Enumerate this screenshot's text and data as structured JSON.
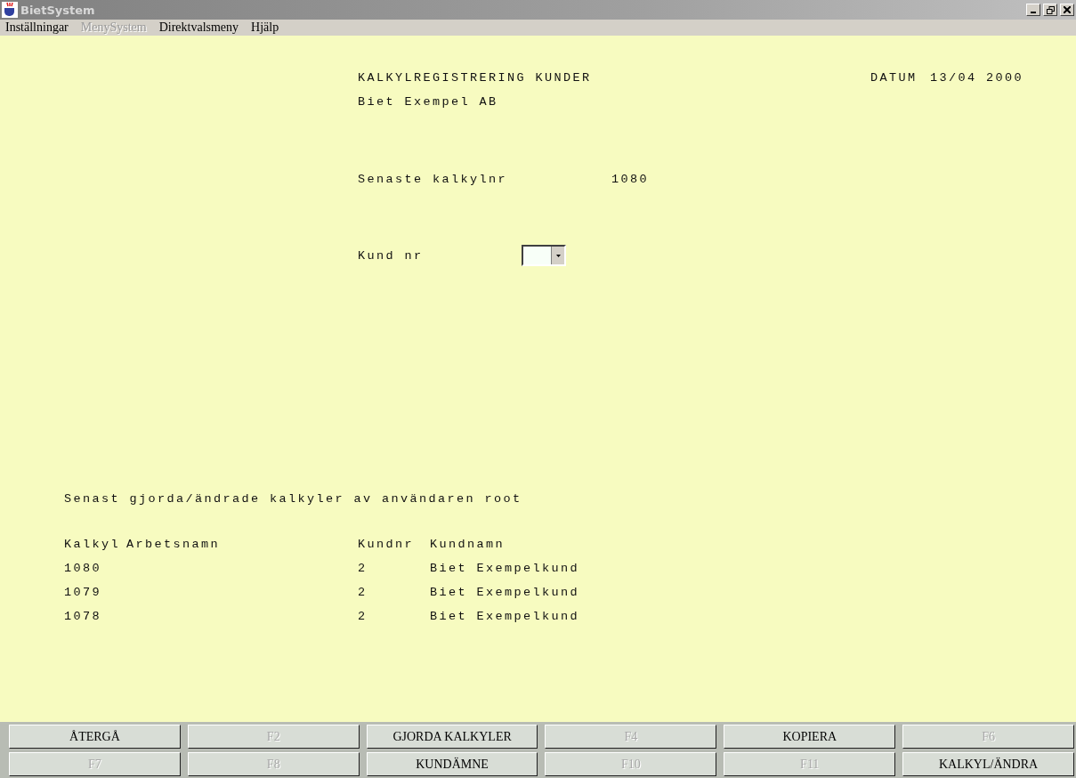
{
  "window": {
    "title": "BietSystem"
  },
  "menu": [
    {
      "label": "Inställningar",
      "disabled": false
    },
    {
      "label": "MenySystem",
      "disabled": true
    },
    {
      "label": "Direktvalsmeny",
      "disabled": false
    },
    {
      "label": "Hjälp",
      "disabled": false
    }
  ],
  "header": {
    "title": "KALKYLREGISTRERING KUNDER",
    "company": "Biet Exempel AB",
    "date_label": "DATUM",
    "date": "13/04 2000"
  },
  "latest": {
    "label": "Senaste kalkylnr",
    "value": "1080"
  },
  "customer": {
    "label": "Kund nr"
  },
  "recent": {
    "caption": "Senast gjorda/ändrade kalkyler av användaren root",
    "columns": [
      "Kalkyl",
      "Arbetsnamn",
      "Kundnr",
      "Kundnamn"
    ],
    "rows": [
      [
        "1080",
        "",
        "2",
        "Biet Exempelkund"
      ],
      [
        "1079",
        "",
        "2",
        "Biet Exempelkund"
      ],
      [
        "1078",
        "",
        "2",
        "Biet Exempelkund"
      ]
    ]
  },
  "buttons": [
    {
      "label": "ÅTERGÅ",
      "disabled": false
    },
    {
      "label": "F2",
      "disabled": true
    },
    {
      "label": "GJORDA KALKYLER",
      "disabled": false
    },
    {
      "label": "F4",
      "disabled": true
    },
    {
      "label": "KOPIERA",
      "disabled": false
    },
    {
      "label": "F6",
      "disabled": true
    },
    {
      "label": "F7",
      "disabled": true
    },
    {
      "label": "F8",
      "disabled": true
    },
    {
      "label": "KUNDÄMNE",
      "disabled": false
    },
    {
      "label": "F10",
      "disabled": true
    },
    {
      "label": "F11",
      "disabled": true
    },
    {
      "label": "KALKYL/ÄNDRA",
      "disabled": false
    }
  ]
}
